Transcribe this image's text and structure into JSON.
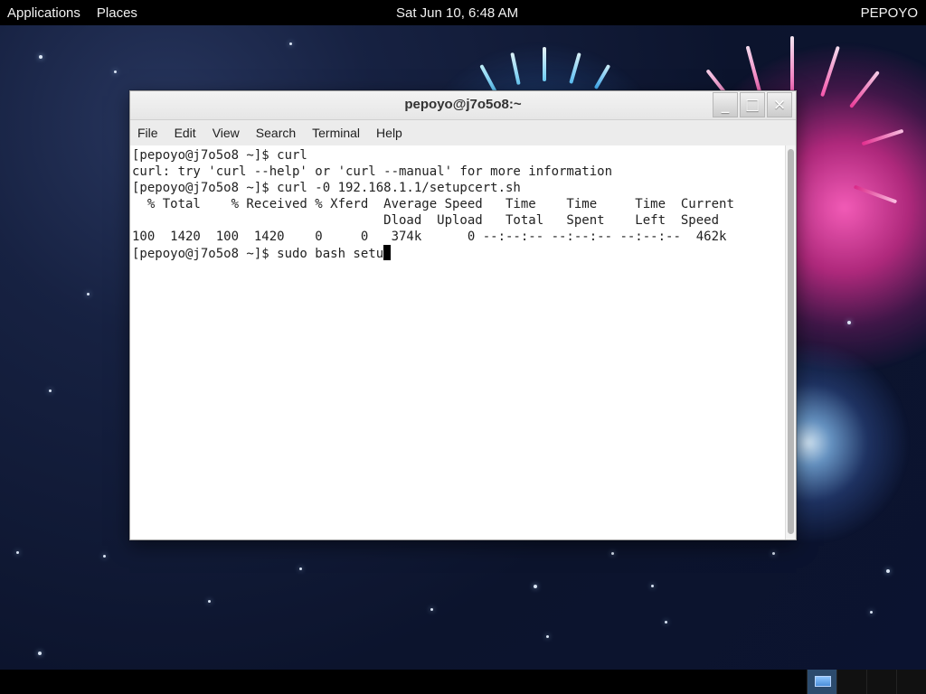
{
  "top_panel": {
    "applications": "Applications",
    "places": "Places",
    "clock": "Sat Jun 10,  6:48 AM",
    "user": "PEPOYO"
  },
  "window": {
    "title": "pepoyo@j7o5o8:~",
    "controls": {
      "minimize": "_",
      "maximize": "□",
      "close": "×"
    },
    "menu": [
      "File",
      "Edit",
      "View",
      "Search",
      "Terminal",
      "Help"
    ]
  },
  "terminal": {
    "lines": [
      "[pepoyo@j7o5o8 ~]$ curl",
      "curl: try 'curl --help' or 'curl --manual' for more information",
      "[pepoyo@j7o5o8 ~]$ curl -0 192.168.1.1/setupcert.sh",
      "  % Total    % Received % Xferd  Average Speed   Time    Time     Time  Current",
      "                                 Dload  Upload   Total   Spent    Left  Speed",
      "100  1420  100  1420    0     0   374k      0 --:--:-- --:--:-- --:--:--  462k",
      "[pepoyo@j7o5o8 ~]$ sudo bash setu"
    ]
  }
}
